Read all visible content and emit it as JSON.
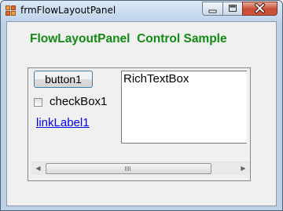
{
  "window": {
    "title": "frmFlowLayoutPanel",
    "controls": {
      "minimize_icon": "minimize-icon",
      "maximize_icon": "maximize-icon",
      "close_icon": "close-icon"
    }
  },
  "form": {
    "heading": "FlowLayoutPanel  Control Sample",
    "heading_color": "#138a13",
    "panel": {
      "button_label": "button1",
      "checkbox_label": "checkBox1",
      "checkbox_checked": false,
      "link_label": "linkLabel1",
      "rich_text": "RichTextBox",
      "scrollbar_thumb_fraction": 0.86
    }
  }
}
